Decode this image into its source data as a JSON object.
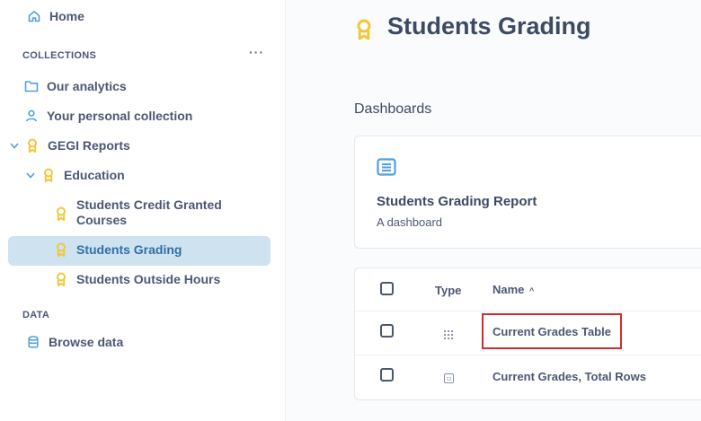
{
  "sidebar": {
    "home_label": "Home",
    "collections_label": "COLLECTIONS",
    "more_label": "···",
    "items": [
      {
        "label": "Our analytics"
      },
      {
        "label": "Your personal collection"
      },
      {
        "label": "GEGI Reports"
      },
      {
        "label": "Education"
      },
      {
        "label": "Students Credit Granted Courses"
      },
      {
        "label": "Students Grading"
      },
      {
        "label": "Students Outside Hours"
      }
    ],
    "data_label": "DATA",
    "browse_label": "Browse data"
  },
  "main": {
    "title": "Students Grading",
    "dashboards_label": "Dashboards",
    "dashboard_card": {
      "title": "Students Grading Report",
      "description": "A dashboard"
    },
    "table": {
      "headers": {
        "type": "Type",
        "name": "Name"
      },
      "sort_indicator": "^",
      "rows": [
        {
          "name": "Current Grades Table",
          "type_icon": "table-grid-icon"
        },
        {
          "name": "Current Grades, Total Rows",
          "type_icon": "number-icon"
        }
      ]
    }
  },
  "colors": {
    "accent": "#509ee3",
    "official_badge": "#f0c83c",
    "active_bg": "#cfe2f0",
    "active_text": "#2f6ea6",
    "highlight": "#d52b2b"
  }
}
